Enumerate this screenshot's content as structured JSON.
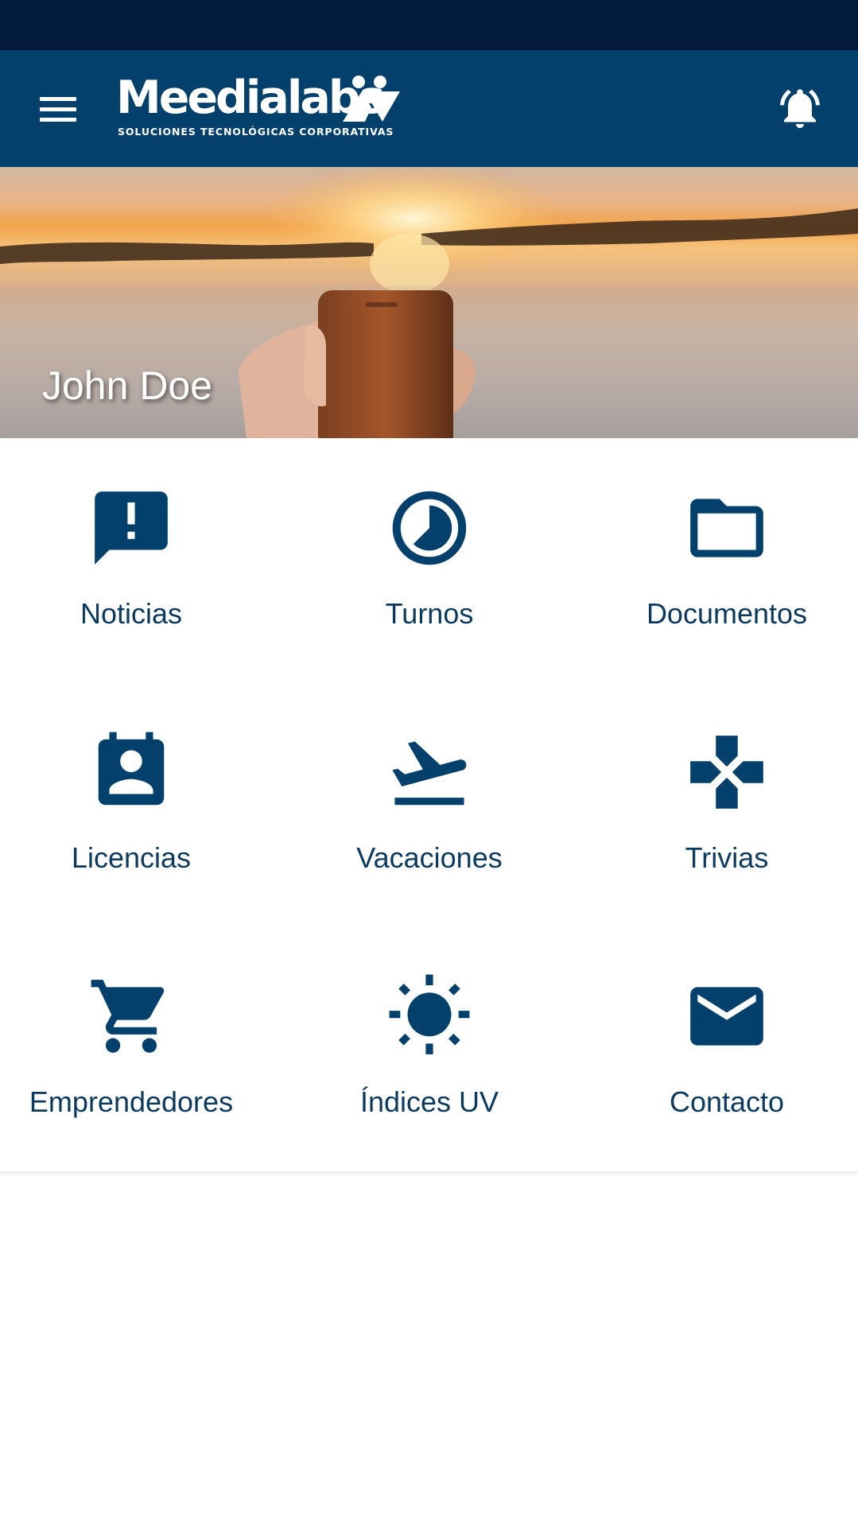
{
  "header": {
    "logo_text": "Meedialabs",
    "logo_tagline": "SOLUCIONES TECNOLÓGICAS CORPORATIVAS",
    "menu_icon": "hamburger-menu-icon",
    "notifications_icon": "bell-ringing-icon"
  },
  "hero": {
    "user_name": "John Doe"
  },
  "menu": {
    "items": [
      {
        "label": "Noticias",
        "icon": "announcement-icon"
      },
      {
        "label": "Turnos",
        "icon": "clock-icon"
      },
      {
        "label": "Documentos",
        "icon": "folder-icon"
      },
      {
        "label": "Licencias",
        "icon": "contact-calendar-icon"
      },
      {
        "label": "Vacaciones",
        "icon": "flight-takeoff-icon"
      },
      {
        "label": "Trivias",
        "icon": "gamepad-icon"
      },
      {
        "label": "Emprendedores",
        "icon": "shopping-cart-icon"
      },
      {
        "label": "Índices UV",
        "icon": "sun-icon"
      },
      {
        "label": "Contacto",
        "icon": "mail-icon"
      }
    ]
  },
  "colors": {
    "status_bar": "#021a3d",
    "app_bar": "#03406b",
    "icon": "#03406b",
    "label": "#0b3a5e"
  }
}
